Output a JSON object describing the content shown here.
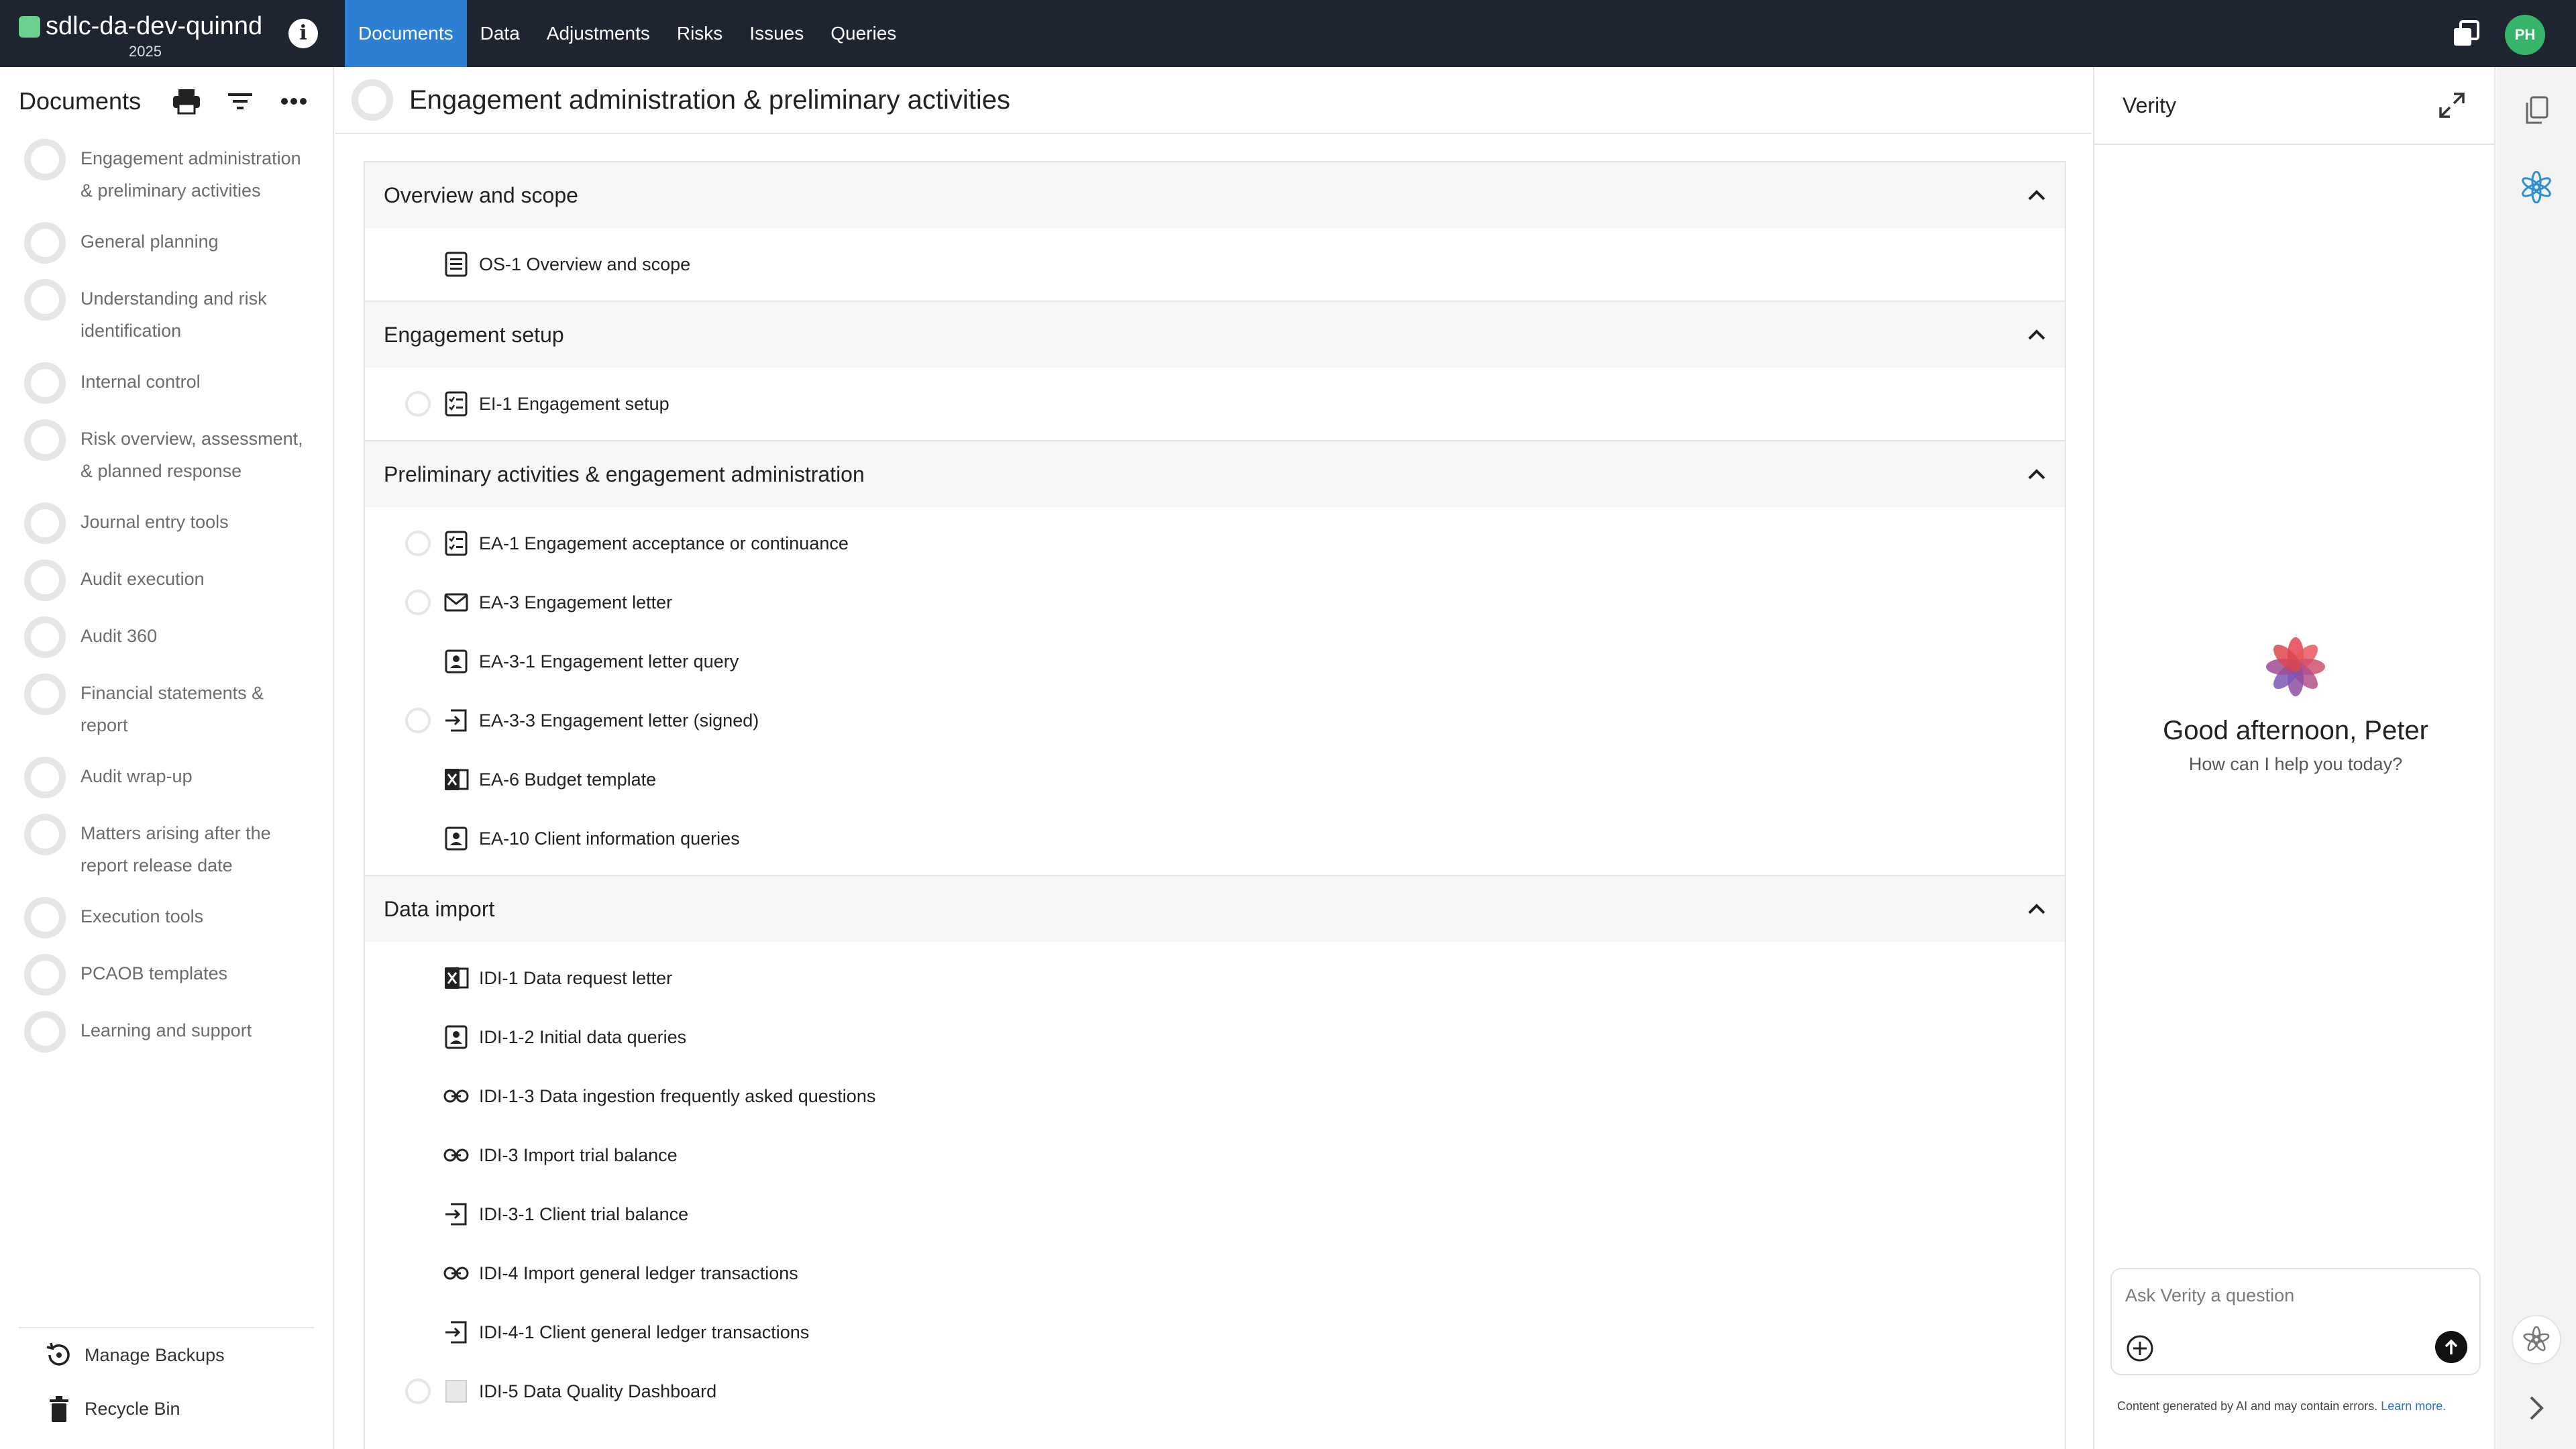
{
  "app": {
    "title": "sdlc-da-dev-quinnd",
    "year": "2025",
    "user_initials": "PH",
    "brand_color": "#6bd08d",
    "accent": "#2d7fd3"
  },
  "nav": [
    {
      "label": "Documents",
      "active": true
    },
    {
      "label": "Data"
    },
    {
      "label": "Adjustments"
    },
    {
      "label": "Risks"
    },
    {
      "label": "Issues"
    },
    {
      "label": "Queries"
    }
  ],
  "sidebar": {
    "title": "Documents",
    "tools": [
      "print-icon",
      "filter-icon",
      "more-icon"
    ],
    "items": [
      "Engagement administration & preliminary activities",
      "General planning",
      "Understanding and risk identification",
      "Internal control",
      "Risk overview, assessment, & planned response",
      "Journal entry tools",
      "Audit execution",
      "Audit 360",
      "Financial statements & report",
      "Audit wrap-up",
      "Matters arising after the report release date",
      "Execution tools",
      "PCAOB templates",
      "Learning and support"
    ],
    "manage_backups": "Manage Backups",
    "recycle_bin": "Recycle Bin"
  },
  "main": {
    "title": "Engagement administration & preliminary activities",
    "sections": [
      {
        "title": "Overview and scope",
        "rows": [
          {
            "label": "OS-1 Overview and scope",
            "icon": "document-icon",
            "selectable": false
          }
        ]
      },
      {
        "title": "Engagement setup",
        "rows": [
          {
            "label": "EI-1 Engagement setup",
            "icon": "checklist-icon",
            "selectable": true
          }
        ]
      },
      {
        "title": "Preliminary activities & engagement administration",
        "rows": [
          {
            "label": "EA-1 Engagement acceptance or continuance",
            "icon": "checklist-icon",
            "selectable": true
          },
          {
            "label": "EA-3 Engagement letter",
            "icon": "mail-icon",
            "selectable": true
          },
          {
            "label": "EA-3-1 Engagement letter query",
            "icon": "query-icon",
            "selectable": false
          },
          {
            "label": "EA-3-3 Engagement letter (signed)",
            "icon": "import-icon",
            "selectable": true
          },
          {
            "label": "EA-6 Budget template",
            "icon": "excel-icon",
            "selectable": false
          },
          {
            "label": "EA-10 Client information queries",
            "icon": "query-icon",
            "selectable": false
          }
        ]
      },
      {
        "title": "Data import",
        "rows": [
          {
            "label": "IDI-1 Data request letter",
            "icon": "excel-icon",
            "selectable": false
          },
          {
            "label": "IDI-1-2 Initial data queries",
            "icon": "query-icon",
            "selectable": false
          },
          {
            "label": "IDI-1-3 Data ingestion frequently asked questions",
            "icon": "link-icon",
            "selectable": false
          },
          {
            "label": "IDI-3 Import trial balance",
            "icon": "link-icon",
            "selectable": false
          },
          {
            "label": "IDI-3-1 Client trial balance",
            "icon": "import-icon",
            "selectable": false
          },
          {
            "label": "IDI-4 Import general ledger transactions",
            "icon": "link-icon",
            "selectable": false
          },
          {
            "label": "IDI-4-1 Client general ledger transactions",
            "icon": "import-icon",
            "selectable": false
          },
          {
            "label": "IDI-5 Data Quality Dashboard",
            "icon": "dashboard-icon",
            "selectable": true
          }
        ]
      }
    ]
  },
  "verity": {
    "title": "Verity",
    "greeting": "Good afternoon, Peter",
    "subtitle": "How can I help you today?",
    "input_placeholder": "Ask Verity a question",
    "disclaimer": "Content generated by AI and may contain errors.",
    "learn_more": "Learn more."
  }
}
